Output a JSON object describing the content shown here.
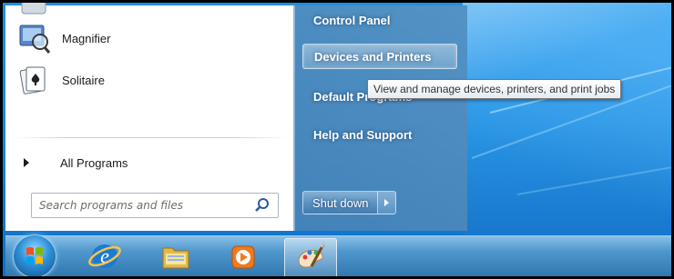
{
  "start_menu": {
    "programs": [
      {
        "label": "Magnifier",
        "icon": "magnifier-icon"
      },
      {
        "label": "Solitaire",
        "icon": "solitaire-icon"
      }
    ],
    "all_programs_label": "All Programs",
    "search_placeholder": "Search programs and files",
    "right_links": {
      "control_panel": "Control Panel",
      "devices_printers": "Devices and Printers",
      "default_programs": "Default Programs",
      "help_support": "Help and Support"
    },
    "shutdown_label": "Shut down"
  },
  "tooltip": {
    "text": "View and manage devices, printers, and print jobs"
  },
  "taskbar": {
    "items": [
      {
        "icon": "start-orb-icon"
      },
      {
        "icon": "internet-explorer-icon"
      },
      {
        "icon": "file-explorer-icon"
      },
      {
        "icon": "media-player-icon"
      },
      {
        "icon": "paint-icon"
      }
    ]
  },
  "colors": {
    "accent_blue": "#3c83b8",
    "taskbar_blue": "#2d74ad",
    "tooltip_bg": "#ffffff"
  }
}
